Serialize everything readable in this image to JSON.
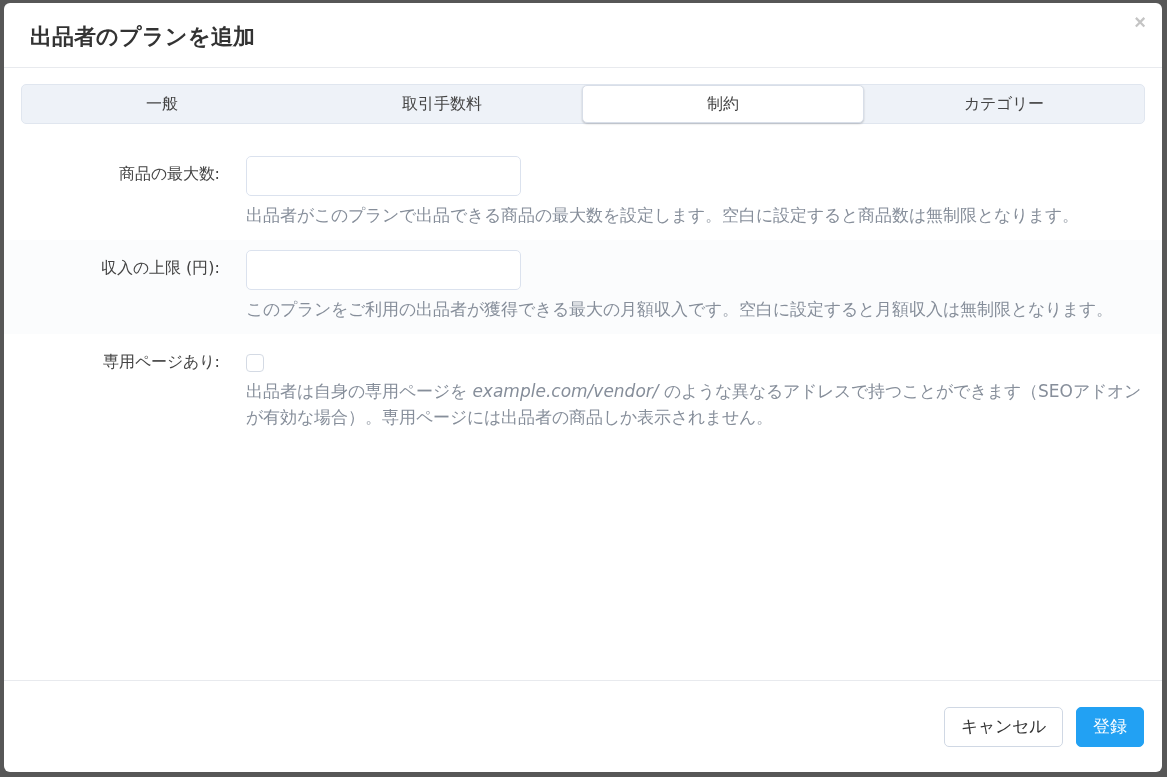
{
  "dialog": {
    "title": "出品者のプランを追加",
    "close": "×"
  },
  "tabs": [
    {
      "label": "一般",
      "selected": false
    },
    {
      "label": "取引手数料",
      "selected": false
    },
    {
      "label": "制約",
      "selected": true
    },
    {
      "label": "カテゴリー",
      "selected": false
    }
  ],
  "fields": [
    {
      "kind": "text",
      "label": "商品の最大数:",
      "help": "出品者がこのプランで出品できる商品の最大数を設定します。空白に設定すると商品数は無制限となります。"
    },
    {
      "kind": "text",
      "label": "収入の上限 (円):",
      "help": "このプランをご利用の出品者が獲得できる最大の月額収入です。空白に設定すると月額収入は無制限となります。"
    },
    {
      "kind": "checkbox",
      "label": "専用ページあり:",
      "checked": false,
      "help": "出品者は自身の専用ページを *example.com/vendor/* のような異なるアドレスで持つことができます（SEOアドオンが有効な場合）。専用ページには出品者の商品しか表示されません。"
    }
  ],
  "buttons": [
    {
      "label": "キャンセル",
      "kind": "secondary"
    },
    {
      "label": "登録",
      "kind": "primary"
    }
  ]
}
